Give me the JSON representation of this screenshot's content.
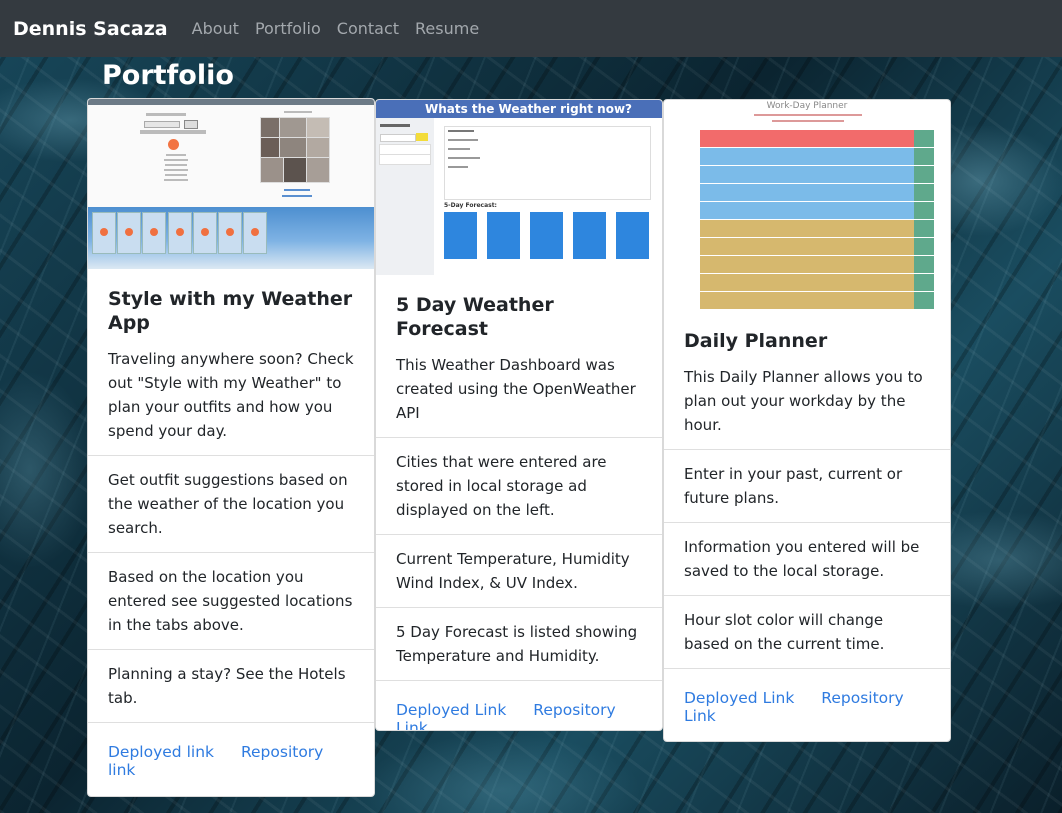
{
  "nav": {
    "brand": "Dennis Sacaza",
    "links": [
      "About",
      "Portfolio",
      "Contact",
      "Resume"
    ]
  },
  "page_title": "Portfolio",
  "cards": [
    {
      "thumb_alt": "Style with my Weather app screenshot",
      "title": "Style with my Weather App",
      "description": "Traveling anywhere soon? Check out \"Style with my Weather\" to plan your outfits and how you spend your day.",
      "items": [
        "Get outfit suggestions based on the weather of the location you search.",
        "Based on the location you entered see suggested locations in the tabs above.",
        "Planning a stay? See the Hotels tab."
      ],
      "deployed_label": "Deployed link",
      "repo_label": "Repository link"
    },
    {
      "thumb_title": "Whats the Weather right now?",
      "thumb_forecast": "5-Day Forecast:",
      "title": "5 Day Weather Forecast",
      "description": "This Weather Dashboard was created using the OpenWeather API",
      "items": [
        "Cities that were entered are stored in local storage ad displayed on the left.",
        "Current Temperature, Humidity Wind Index, & UV Index.",
        "5 Day Forecast is listed showing Temperature and Humidity."
      ],
      "deployed_label": "Deployed Link",
      "repo_label": "Repository Link"
    },
    {
      "thumb_title": "Work-Day Planner",
      "title": "Daily Planner",
      "description": "This Daily Planner allows you to plan out your workday by the hour.",
      "items": [
        "Enter in your past, current or future plans.",
        "Information you entered will be saved to the local storage.",
        "Hour slot color will change based on the current time."
      ],
      "deployed_label": "Deployed Link",
      "repo_label": "Repository Link"
    }
  ],
  "colors": {
    "navbar": "#343a40",
    "link": "#2f7be0",
    "past": "#f26b6b",
    "present": "#7bbbe9",
    "future": "#d6b86e",
    "save": "#5fa98c"
  }
}
